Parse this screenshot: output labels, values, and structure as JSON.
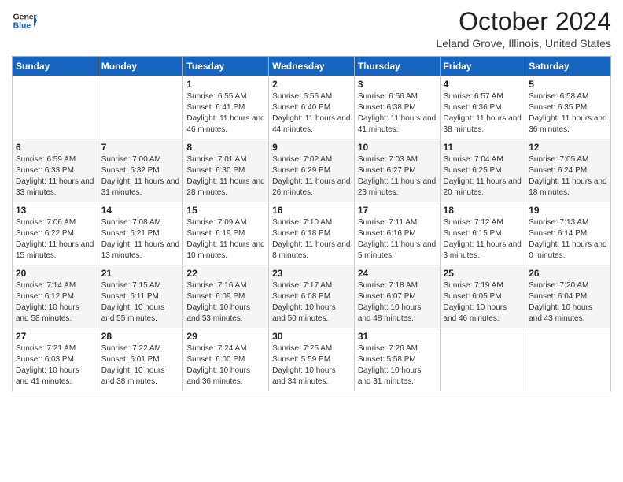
{
  "header": {
    "logo_general": "General",
    "logo_blue": "Blue",
    "month": "October 2024",
    "location": "Leland Grove, Illinois, United States"
  },
  "weekdays": [
    "Sunday",
    "Monday",
    "Tuesday",
    "Wednesday",
    "Thursday",
    "Friday",
    "Saturday"
  ],
  "weeks": [
    [
      {
        "day": "",
        "sunrise": "",
        "sunset": "",
        "daylight": ""
      },
      {
        "day": "",
        "sunrise": "",
        "sunset": "",
        "daylight": ""
      },
      {
        "day": "1",
        "sunrise": "Sunrise: 6:55 AM",
        "sunset": "Sunset: 6:41 PM",
        "daylight": "Daylight: 11 hours and 46 minutes."
      },
      {
        "day": "2",
        "sunrise": "Sunrise: 6:56 AM",
        "sunset": "Sunset: 6:40 PM",
        "daylight": "Daylight: 11 hours and 44 minutes."
      },
      {
        "day": "3",
        "sunrise": "Sunrise: 6:56 AM",
        "sunset": "Sunset: 6:38 PM",
        "daylight": "Daylight: 11 hours and 41 minutes."
      },
      {
        "day": "4",
        "sunrise": "Sunrise: 6:57 AM",
        "sunset": "Sunset: 6:36 PM",
        "daylight": "Daylight: 11 hours and 38 minutes."
      },
      {
        "day": "5",
        "sunrise": "Sunrise: 6:58 AM",
        "sunset": "Sunset: 6:35 PM",
        "daylight": "Daylight: 11 hours and 36 minutes."
      }
    ],
    [
      {
        "day": "6",
        "sunrise": "Sunrise: 6:59 AM",
        "sunset": "Sunset: 6:33 PM",
        "daylight": "Daylight: 11 hours and 33 minutes."
      },
      {
        "day": "7",
        "sunrise": "Sunrise: 7:00 AM",
        "sunset": "Sunset: 6:32 PM",
        "daylight": "Daylight: 11 hours and 31 minutes."
      },
      {
        "day": "8",
        "sunrise": "Sunrise: 7:01 AM",
        "sunset": "Sunset: 6:30 PM",
        "daylight": "Daylight: 11 hours and 28 minutes."
      },
      {
        "day": "9",
        "sunrise": "Sunrise: 7:02 AM",
        "sunset": "Sunset: 6:29 PM",
        "daylight": "Daylight: 11 hours and 26 minutes."
      },
      {
        "day": "10",
        "sunrise": "Sunrise: 7:03 AM",
        "sunset": "Sunset: 6:27 PM",
        "daylight": "Daylight: 11 hours and 23 minutes."
      },
      {
        "day": "11",
        "sunrise": "Sunrise: 7:04 AM",
        "sunset": "Sunset: 6:25 PM",
        "daylight": "Daylight: 11 hours and 20 minutes."
      },
      {
        "day": "12",
        "sunrise": "Sunrise: 7:05 AM",
        "sunset": "Sunset: 6:24 PM",
        "daylight": "Daylight: 11 hours and 18 minutes."
      }
    ],
    [
      {
        "day": "13",
        "sunrise": "Sunrise: 7:06 AM",
        "sunset": "Sunset: 6:22 PM",
        "daylight": "Daylight: 11 hours and 15 minutes."
      },
      {
        "day": "14",
        "sunrise": "Sunrise: 7:08 AM",
        "sunset": "Sunset: 6:21 PM",
        "daylight": "Daylight: 11 hours and 13 minutes."
      },
      {
        "day": "15",
        "sunrise": "Sunrise: 7:09 AM",
        "sunset": "Sunset: 6:19 PM",
        "daylight": "Daylight: 11 hours and 10 minutes."
      },
      {
        "day": "16",
        "sunrise": "Sunrise: 7:10 AM",
        "sunset": "Sunset: 6:18 PM",
        "daylight": "Daylight: 11 hours and 8 minutes."
      },
      {
        "day": "17",
        "sunrise": "Sunrise: 7:11 AM",
        "sunset": "Sunset: 6:16 PM",
        "daylight": "Daylight: 11 hours and 5 minutes."
      },
      {
        "day": "18",
        "sunrise": "Sunrise: 7:12 AM",
        "sunset": "Sunset: 6:15 PM",
        "daylight": "Daylight: 11 hours and 3 minutes."
      },
      {
        "day": "19",
        "sunrise": "Sunrise: 7:13 AM",
        "sunset": "Sunset: 6:14 PM",
        "daylight": "Daylight: 11 hours and 0 minutes."
      }
    ],
    [
      {
        "day": "20",
        "sunrise": "Sunrise: 7:14 AM",
        "sunset": "Sunset: 6:12 PM",
        "daylight": "Daylight: 10 hours and 58 minutes."
      },
      {
        "day": "21",
        "sunrise": "Sunrise: 7:15 AM",
        "sunset": "Sunset: 6:11 PM",
        "daylight": "Daylight: 10 hours and 55 minutes."
      },
      {
        "day": "22",
        "sunrise": "Sunrise: 7:16 AM",
        "sunset": "Sunset: 6:09 PM",
        "daylight": "Daylight: 10 hours and 53 minutes."
      },
      {
        "day": "23",
        "sunrise": "Sunrise: 7:17 AM",
        "sunset": "Sunset: 6:08 PM",
        "daylight": "Daylight: 10 hours and 50 minutes."
      },
      {
        "day": "24",
        "sunrise": "Sunrise: 7:18 AM",
        "sunset": "Sunset: 6:07 PM",
        "daylight": "Daylight: 10 hours and 48 minutes."
      },
      {
        "day": "25",
        "sunrise": "Sunrise: 7:19 AM",
        "sunset": "Sunset: 6:05 PM",
        "daylight": "Daylight: 10 hours and 46 minutes."
      },
      {
        "day": "26",
        "sunrise": "Sunrise: 7:20 AM",
        "sunset": "Sunset: 6:04 PM",
        "daylight": "Daylight: 10 hours and 43 minutes."
      }
    ],
    [
      {
        "day": "27",
        "sunrise": "Sunrise: 7:21 AM",
        "sunset": "Sunset: 6:03 PM",
        "daylight": "Daylight: 10 hours and 41 minutes."
      },
      {
        "day": "28",
        "sunrise": "Sunrise: 7:22 AM",
        "sunset": "Sunset: 6:01 PM",
        "daylight": "Daylight: 10 hours and 38 minutes."
      },
      {
        "day": "29",
        "sunrise": "Sunrise: 7:24 AM",
        "sunset": "Sunset: 6:00 PM",
        "daylight": "Daylight: 10 hours and 36 minutes."
      },
      {
        "day": "30",
        "sunrise": "Sunrise: 7:25 AM",
        "sunset": "Sunset: 5:59 PM",
        "daylight": "Daylight: 10 hours and 34 minutes."
      },
      {
        "day": "31",
        "sunrise": "Sunrise: 7:26 AM",
        "sunset": "Sunset: 5:58 PM",
        "daylight": "Daylight: 10 hours and 31 minutes."
      },
      {
        "day": "",
        "sunrise": "",
        "sunset": "",
        "daylight": ""
      },
      {
        "day": "",
        "sunrise": "",
        "sunset": "",
        "daylight": ""
      }
    ]
  ]
}
